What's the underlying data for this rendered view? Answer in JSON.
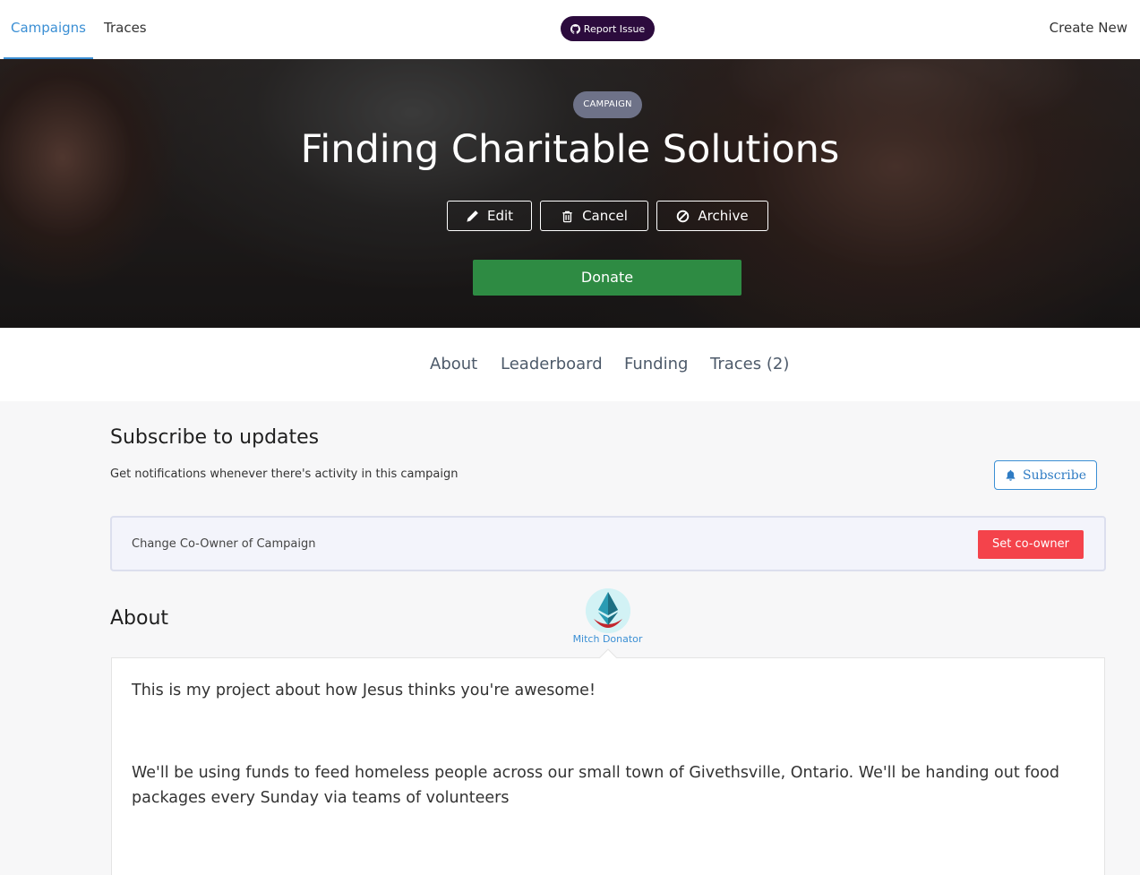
{
  "nav": {
    "tabs": [
      {
        "label": "Campaigns",
        "active": true
      },
      {
        "label": "Traces",
        "active": false
      }
    ],
    "report_issue": "Report Issue",
    "create_new": "Create New"
  },
  "hero": {
    "badge": "CAMPAIGN",
    "title": "Finding Charitable Solutions",
    "actions": {
      "edit": "Edit",
      "cancel": "Cancel",
      "archive": "Archive"
    },
    "donate": "Donate"
  },
  "subnav": {
    "items": [
      "About",
      "Leaderboard",
      "Funding",
      "Traces (2)"
    ]
  },
  "subscribe": {
    "heading": "Subscribe to updates",
    "text": "Get notifications whenever there's activity in this campaign",
    "button": "Subscribe"
  },
  "coowner": {
    "text": "Change Co-Owner of Campaign",
    "button": "Set co-owner"
  },
  "about": {
    "heading": "About",
    "owner_name": "Mitch Donator",
    "paragraphs": [
      "This is my project about how Jesus thinks you're awesome!",
      "We'll be using funds to feed homeless people across our small town of Givethsville, Ontario. We'll be handing out food packages every Sunday via teams of volunteers"
    ]
  },
  "colors": {
    "accent": "#3b8fd4",
    "donate": "#2e8b43",
    "danger": "#f4434b",
    "report": "#2c0b3d"
  }
}
